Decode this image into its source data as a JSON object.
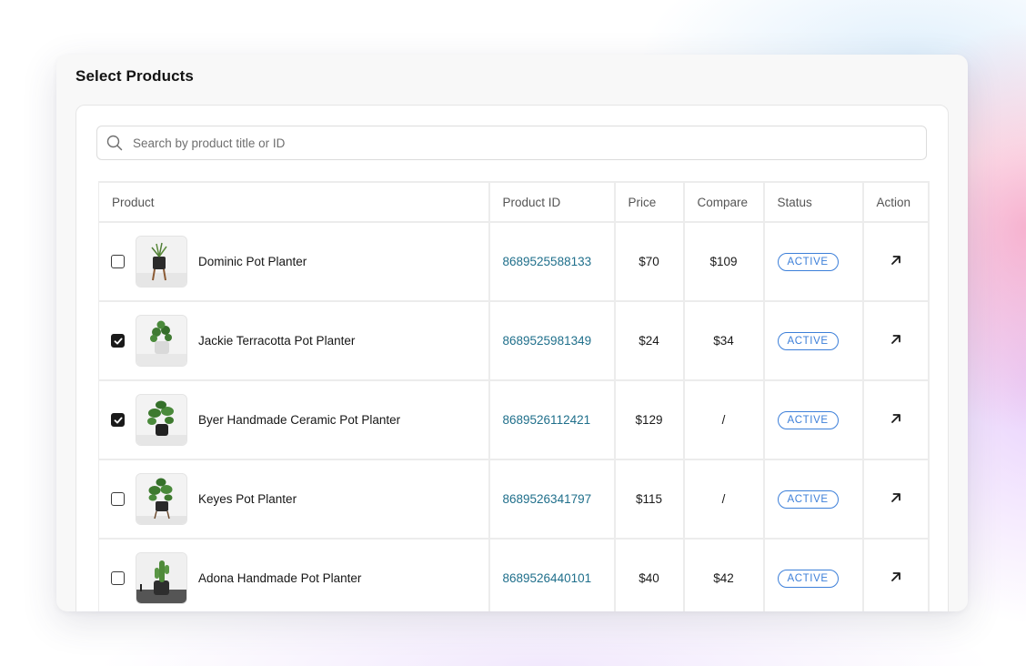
{
  "page": {
    "title": "Select Products"
  },
  "search": {
    "placeholder": "Search by product title or ID",
    "icon": "search-icon"
  },
  "table": {
    "columns": {
      "product": "Product",
      "product_id": "Product ID",
      "price": "Price",
      "compare": "Compare",
      "status": "Status",
      "action": "Action"
    },
    "rows": [
      {
        "checked": false,
        "name": "Dominic Pot Planter",
        "product_id": "8689525588133",
        "price": "$70",
        "compare": "$109",
        "status": "ACTIVE",
        "action_icon": "arrow-up-right-icon",
        "thumb": "wooden-stand-planter"
      },
      {
        "checked": true,
        "name": "Jackie Terracotta Pot Planter",
        "product_id": "8689525981349",
        "price": "$24",
        "compare": "$34",
        "status": "ACTIVE",
        "action_icon": "arrow-up-right-icon",
        "thumb": "white-pot-pilea"
      },
      {
        "checked": true,
        "name": "Byer Handmade Ceramic Pot Planter",
        "product_id": "8689526112421",
        "price": "$129",
        "compare": "/",
        "status": "ACTIVE",
        "action_icon": "arrow-up-right-icon",
        "thumb": "black-pot-leafy"
      },
      {
        "checked": false,
        "name": "Keyes Pot Planter",
        "product_id": "8689526341797",
        "price": "$115",
        "compare": "/",
        "status": "ACTIVE",
        "action_icon": "arrow-up-right-icon",
        "thumb": "stand-pot-leafy"
      },
      {
        "checked": false,
        "name": "Adona Handmade Pot Planter",
        "product_id": "8689526440101",
        "price": "$40",
        "compare": "$42",
        "status": "ACTIVE",
        "action_icon": "arrow-up-right-icon",
        "thumb": "dark-pot-cactus"
      }
    ]
  },
  "colors": {
    "link": "#1f6f8b",
    "status_badge": "#3c7fd9",
    "checkbox_checked": "#1a1a1a"
  }
}
